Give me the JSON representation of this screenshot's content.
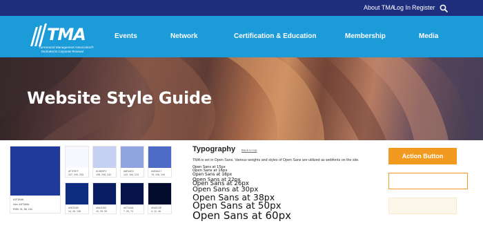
{
  "topbar": {
    "links": [
      "About TMA",
      "Log In",
      "Register"
    ],
    "search_icon": "search-icon"
  },
  "logo": {
    "name": "TMA",
    "tagline": "Turnaround Management Association®",
    "subtagline": "Dedicated to Corporate Renewal"
  },
  "nav": {
    "items": [
      "Events",
      "Network",
      "Certification & Education",
      "Membership",
      "Media"
    ]
  },
  "hero": {
    "title": "Website Style Guide"
  },
  "colors": {
    "brand_navy": "#1f2d7d",
    "brand_blue": "#1b9bd7",
    "accent_orange": "#f29a1f"
  },
  "swatches": {
    "primary": {
      "name": "#1F3A9A",
      "hex": "Hex: #1F3A9A",
      "rgb": "RGB: 31, 58, 154",
      "color": "#1f3a9a"
    },
    "tints": [
      {
        "name": "#F7F9FF",
        "rgb": "247, 249, 255",
        "color": "#f7f9ff"
      },
      {
        "name": "#C6D0F2",
        "rgb": "198, 208, 242",
        "color": "#c6d0f2"
      },
      {
        "name": "#8FA4E0",
        "rgb": "143, 164, 224",
        "color": "#8fa4e0"
      },
      {
        "name": "#4E6AC7",
        "rgb": "78, 106, 199",
        "color": "#4e6ac7"
      }
    ],
    "shades": [
      {
        "name": "#0E2D80",
        "rgb": "14, 45, 128",
        "color": "#0e2d80"
      },
      {
        "name": "#0A1D63",
        "rgb": "10, 29, 99",
        "color": "#0a1d63"
      },
      {
        "name": "#07144A",
        "rgb": "7, 20, 74",
        "color": "#07144a"
      },
      {
        "name": "#040C2E",
        "rgb": "4, 12, 46",
        "color": "#040c2e"
      }
    ]
  },
  "typography": {
    "title": "Typography",
    "back_to_top": "Back to top",
    "description": "TMA is set in Open Sans. Various weights and styles of Open Sans are utilized as webfonts on the site.",
    "samples": [
      "Open Sans at 15px",
      "Open Sans at 16px",
      "Open Sans at 18px",
      "Open Sans at 22px",
      "Open Sans at 26px",
      "Open Sans at 30px",
      "Open Sans at 38px",
      "Open Sans at 50px",
      "Open Sans at 60px"
    ]
  },
  "buttons": {
    "action": "Action Button"
  }
}
